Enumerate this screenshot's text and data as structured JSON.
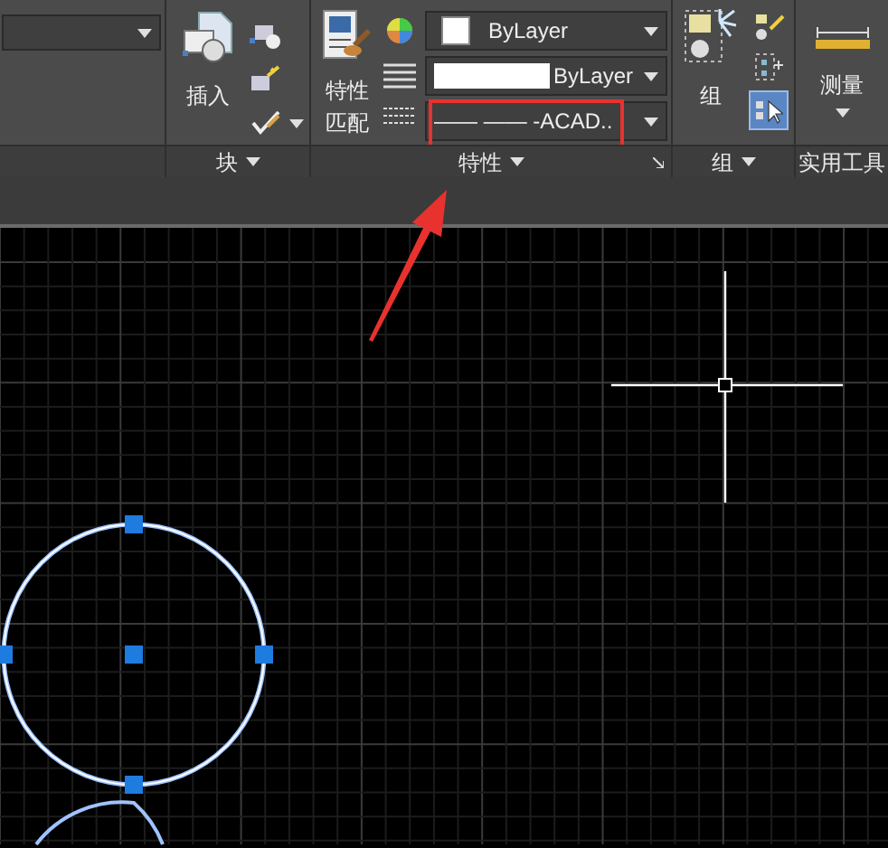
{
  "ribbon": {
    "panels": [
      {
        "kind": "blank"
      },
      {
        "kind": "block",
        "title": "块",
        "button": "插入"
      },
      {
        "kind": "properties",
        "title": "特性",
        "button": "特性匹配",
        "dropdowns": [
          {
            "kind": "swatch",
            "value": "ByLayer",
            "highlighted": false
          },
          {
            "kind": "bar",
            "value": "ByLayer",
            "highlighted": false
          },
          {
            "kind": "linetype",
            "value": "—— —— -ACAD..",
            "highlighted": true
          }
        ]
      },
      {
        "kind": "group",
        "title": "组",
        "button": "组",
        "tool_selected": true
      },
      {
        "kind": "utility",
        "title": "实用工具",
        "button": "测量"
      }
    ]
  }
}
